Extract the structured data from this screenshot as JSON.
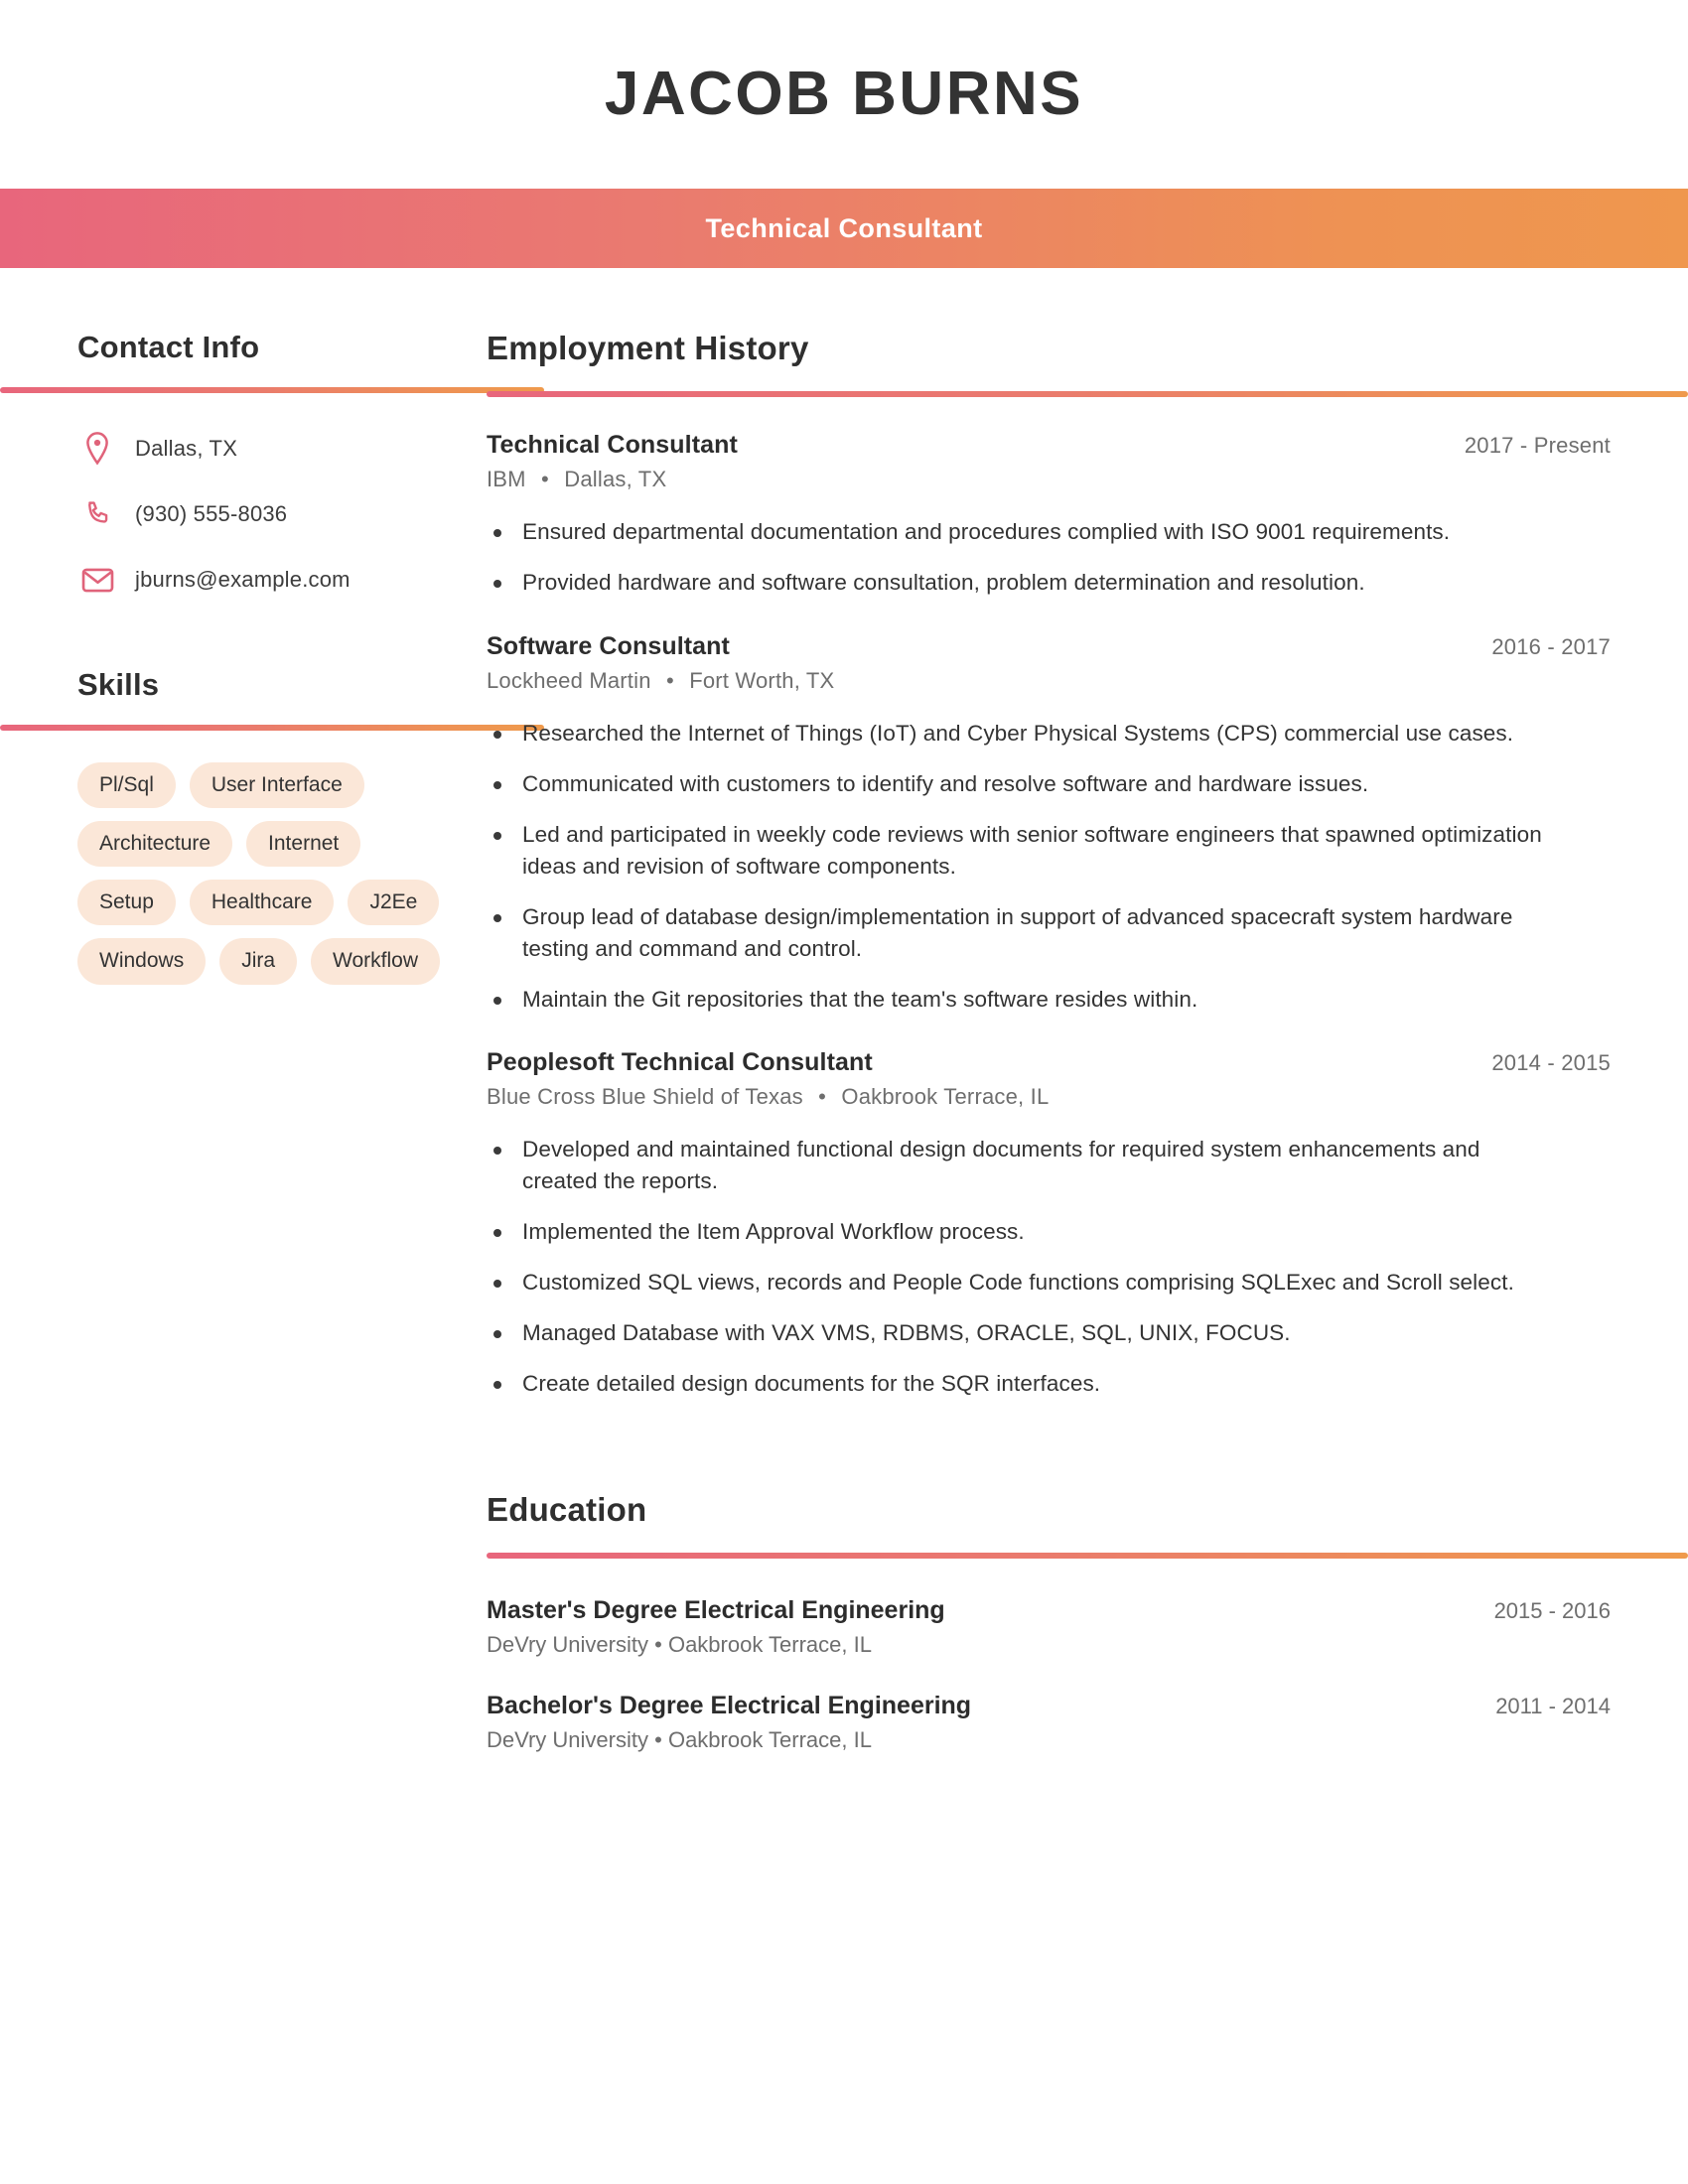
{
  "header": {
    "name": "JACOB BURNS",
    "title": "Technical Consultant",
    "accent_start": "#e8667c",
    "accent_end": "#ef974e"
  },
  "sidebar": {
    "contact": {
      "heading": "Contact Info",
      "items": [
        {
          "icon": "map-pin-icon",
          "value": "Dallas, TX"
        },
        {
          "icon": "phone-icon",
          "value": "(930) 555-8036"
        },
        {
          "icon": "envelope-icon",
          "value": "jburns@example.com"
        }
      ]
    },
    "skills": {
      "heading": "Skills",
      "chip_bg": "#fbe7d8",
      "items": [
        "Pl/Sql",
        "User Interface",
        "Architecture",
        "Internet",
        "Setup",
        "Healthcare",
        "J2Ee",
        "Windows",
        "Jira",
        "Workflow"
      ]
    }
  },
  "main": {
    "employment": {
      "heading": "Employment History",
      "entries": [
        {
          "role": "Technical Consultant",
          "dates": "2017 - Present",
          "company": "IBM",
          "location": "Dallas, TX",
          "bullets": [
            "Ensured departmental documentation and procedures complied with ISO 9001 requirements.",
            "Provided hardware and software consultation, problem determination and resolution."
          ]
        },
        {
          "role": "Software Consultant",
          "dates": "2016 - 2017",
          "company": "Lockheed Martin",
          "location": "Fort Worth, TX",
          "bullets": [
            "Researched the Internet of Things (IoT) and Cyber Physical Systems (CPS) commercial use cases.",
            "Communicated with customers to identify and resolve software and hardware issues.",
            "Led and participated in weekly code reviews with senior software engineers that spawned optimization ideas and revision of software components.",
            "Group lead of database design/implementation in support of advanced spacecraft system hardware testing and command and control.",
            "Maintain the Git repositories that the team's software resides within."
          ]
        },
        {
          "role": "Peoplesoft Technical Consultant",
          "dates": "2014 - 2015",
          "company": "Blue Cross Blue Shield of Texas",
          "location": "Oakbrook Terrace, IL",
          "bullets": [
            "Developed and maintained functional design documents for required system enhancements and created the reports.",
            "Implemented the Item Approval Workflow process.",
            "Customized SQL views, records and People Code functions comprising SQLExec and Scroll select.",
            "Managed Database with VAX VMS, RDBMS, ORACLE, SQL, UNIX, FOCUS.",
            "Create detailed design documents for the SQR interfaces."
          ]
        }
      ]
    },
    "education": {
      "heading": "Education",
      "entries": [
        {
          "degree": "Master's Degree Electrical Engineering",
          "dates": "2015 - 2016",
          "school": "DeVry University",
          "location": "Oakbrook Terrace, IL"
        },
        {
          "degree": "Bachelor's Degree Electrical Engineering",
          "dates": "2011 - 2014",
          "school": "DeVry University",
          "location": "Oakbrook Terrace, IL"
        }
      ]
    }
  },
  "separator": "•"
}
